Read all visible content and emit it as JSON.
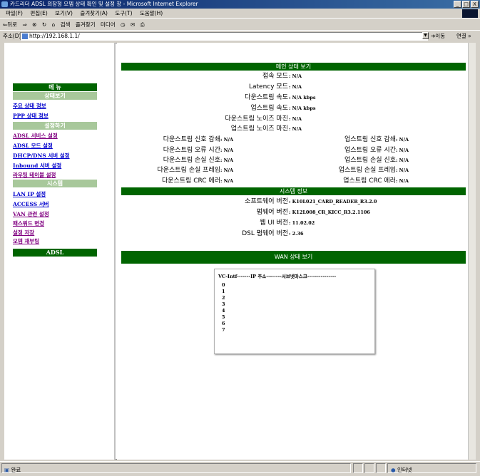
{
  "window": {
    "title": "카드리더 ADSL 외장형 모뎀 상태 확인 및 설정 창 - Microsoft Internet Explorer",
    "controls": [
      "_",
      "□",
      "X"
    ]
  },
  "menubar": {
    "items": [
      "파일(F)",
      "편집(E)",
      "보기(V)",
      "즐겨찾기(A)",
      "도구(T)",
      "도움말(H)"
    ]
  },
  "toolbar": {
    "back": "⇐뒤로",
    "forward": "⇒",
    "search": "검색",
    "favorites": "즐겨찾기",
    "media": "미디어"
  },
  "address": {
    "label": "주소(D)",
    "url": "http://192.168.1.1/",
    "go": "이동",
    "links": "연결 »"
  },
  "sidebar": {
    "title": "메 뉴",
    "sections": [
      {
        "title": "상태보기",
        "items": [
          "주요 상태 정보",
          "PPP 상태 정보"
        ]
      },
      {
        "title": "설정하기",
        "items": [
          "ADSL 서비스 설정",
          "ADSL 모드 설정",
          "DHCP/DNS 서버 설정",
          "Inbound 서버 설정",
          "라우팅 테이블 설정"
        ]
      },
      {
        "title": "시스템",
        "items": [
          "LAN IP 설정",
          "ACCESS 서버",
          "VAN 관련 설정",
          "패스워드 변경",
          "설정 저장",
          "모뎀 재부팅"
        ]
      }
    ],
    "footer": "ADSL"
  },
  "main_status": {
    "title": "메인 상태 보기",
    "rows": [
      {
        "label": "접속 모드",
        "value": ": N/A"
      },
      {
        "label": "Latency 모드",
        "value": ": N/A"
      },
      {
        "label": "다운스트림 속도",
        "value": ": N/A kbps"
      },
      {
        "label": "업스트림 속도",
        "value": ": N/A kbps"
      },
      {
        "label": "다운스트림 노이즈 마진",
        "value": ": N/A"
      },
      {
        "label": "업스트림 노이즈 마진",
        "value": ": N/A"
      }
    ],
    "pairs": [
      {
        "dl": "다운스트림 신호 감쇄",
        "dv": ": N/A",
        "ul": "업스트림 신호 감쇄",
        "uv": ": N/A"
      },
      {
        "dl": "다운스트림 오류 시간",
        "dv": ": N/A",
        "ul": "업스트림 오류 시간",
        "uv": ": N/A"
      },
      {
        "dl": "다운스트림 손실 신호",
        "dv": ": N/A",
        "ul": "업스트림 손실 신호",
        "uv": ": N/A"
      },
      {
        "dl": "다운스트림 손실 프레임",
        "dv": ": N/A",
        "ul": "업스트림 손실 프레임",
        "uv": ": N/A"
      },
      {
        "dl": "다운스트림 CRC 에러",
        "dv": ": N/A",
        "ul": "업스트림 CRC 에러",
        "uv": ": N/A"
      }
    ]
  },
  "system_info": {
    "title": "시스템 정보",
    "rows": [
      {
        "label": "소프트웨어 버전",
        "value": ": K10L021_CARD_READER_R3.2.0"
      },
      {
        "label": "펌웨어 버전",
        "value": ": K12L008_CR_KICC_R3.2.1106"
      },
      {
        "label": "웹 UI 버전",
        "value": ": 11.02.02"
      },
      {
        "label": "DSL 펌웨어 버전",
        "value": ": 2.36"
      }
    ]
  },
  "wan": {
    "title": "WAN 상태 보기",
    "header": "VC-Intf-------IP 주소--------서브넷마스크---------------",
    "rows": [
      "0",
      "1",
      "2",
      "3",
      "4",
      "5",
      "6",
      "7"
    ]
  },
  "statusbar": {
    "status": "완료",
    "zone": "인터넷"
  }
}
